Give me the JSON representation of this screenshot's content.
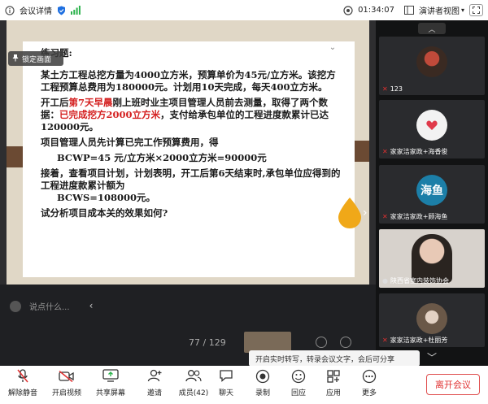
{
  "topbar": {
    "title": "会议详情",
    "time": "01:34:07",
    "view_label": "演讲者视图"
  },
  "share": {
    "lock_label": "锁定画面",
    "slide": {
      "heading": "练习题:",
      "para1": "某土方工程总挖方量为4000立方米，预算单价为45元/立方米。该挖方工程预算总费用为180000元。计划用10天完成，每天400立方米。",
      "para2_a": "开工后",
      "para2_red1": "第7天早晨",
      "para2_b": "刚上班时业主项目管理人员前去测量，取得了两个数据：",
      "para2_red2": "已完成挖方2000立方米",
      "para2_c": "，支付给承包单位的工程进度款累计已达120000元。",
      "para3": "项目管理人员先计算已完工作预算费用，得",
      "formula1": "BCWP=45 元/立方米×2000立方米=90000元",
      "para4": "接着，查看项目计划，计划表明，开工后第6天结束时,承包单位应得到的工程进度款累计额为",
      "formula2": "BCWS=108000元。",
      "para5": "试分析项目成本关的效果如何?"
    },
    "pager": "77 / 129"
  },
  "chat": {
    "placeholder": "说点什么..."
  },
  "gallery": {
    "tiles": [
      {
        "name": "123"
      },
      {
        "name": "家家洁家政+海香俊"
      },
      {
        "name": "家家洁家政+顾海鱼",
        "avatar_text": "海鱼"
      },
      {
        "name": "陕西省室内装饰协会"
      },
      {
        "name": "家家洁家政+杜丽芳"
      }
    ]
  },
  "tooltip": "开启实时转写，转录会议文字，会后可分享",
  "toolbar": {
    "items": [
      {
        "label": "解除静音",
        "icon": "mic-muted-icon"
      },
      {
        "label": "开启视频",
        "icon": "video-off-icon"
      },
      {
        "label": "共享屏幕",
        "icon": "share-screen-icon"
      },
      {
        "label": "邀请",
        "icon": "invite-icon"
      },
      {
        "label": "成员(42)",
        "icon": "members-icon"
      },
      {
        "label": "聊天",
        "icon": "chat-icon"
      },
      {
        "label": "录制",
        "icon": "record-icon"
      },
      {
        "label": "回应",
        "icon": "reaction-icon"
      },
      {
        "label": "应用",
        "icon": "apps-icon"
      },
      {
        "label": "更多",
        "icon": "more-icon"
      }
    ],
    "leave_label": "离开会议"
  },
  "colors": {
    "accent_red": "#e03030",
    "slide_red": "#d42020",
    "slide_frame": "#e0d7c6",
    "band_brown": "#6b4a33"
  }
}
